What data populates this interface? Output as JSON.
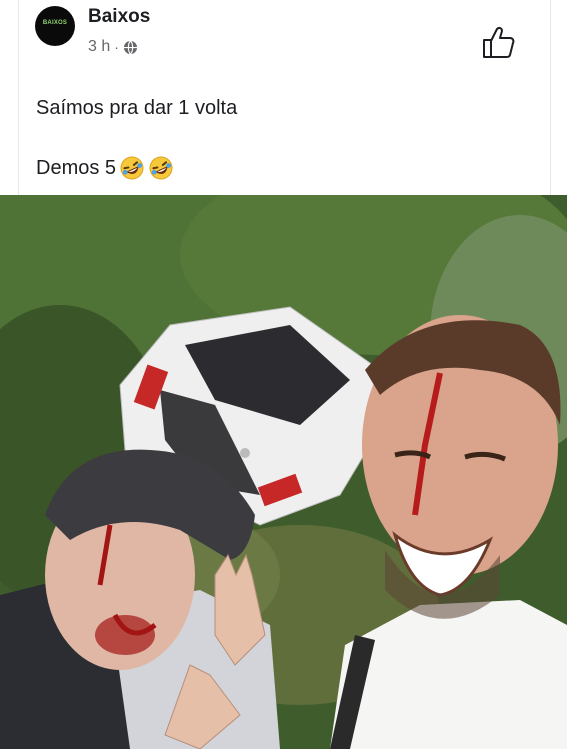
{
  "post": {
    "author": "Baixos",
    "avatar_text": "BAIXOS",
    "time": "3 h",
    "visibility_icon": "globe-icon",
    "text_line1": "Saímos pra dar 1 volta",
    "text_line2": "Demos 5",
    "emoji": "rolling-on-floor-laughing",
    "like_icon": "thumbs-up-icon"
  },
  "colors": {
    "text": "#1c1e21",
    "meta": "#65676b",
    "foliage": "#4b6b35",
    "car": "#f2f2f2"
  }
}
